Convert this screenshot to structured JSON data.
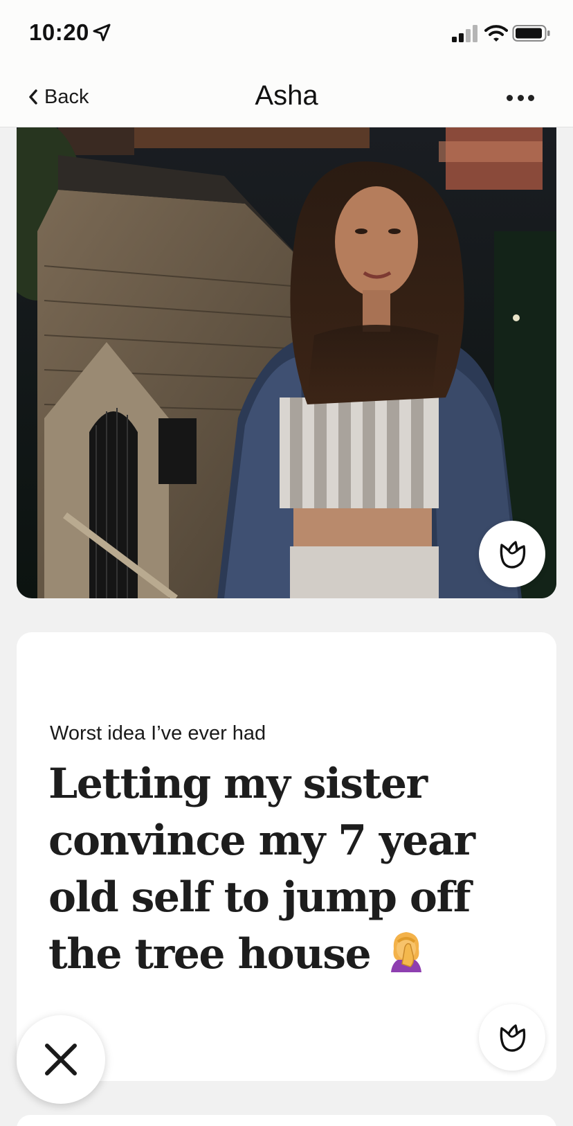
{
  "status_bar": {
    "time": "10:20",
    "icons": [
      "location-arrow-icon",
      "cellular-signal-icon",
      "wifi-icon",
      "battery-icon"
    ]
  },
  "nav": {
    "back_label": "Back",
    "title": "Asha",
    "more_icon": "more-horizontal-icon"
  },
  "photo": {
    "like_icon": "rose-icon"
  },
  "prompt": {
    "question": "Worst idea I’ve ever had",
    "answer": "Letting my sister convince my 7 year old self to jump off the tree house",
    "answer_emoji": "woman-facepalming",
    "like_icon": "rose-icon"
  },
  "actions": {
    "skip_icon": "close-icon"
  },
  "colors": {
    "background": "#f1f1f1",
    "card": "#ffffff",
    "text": "#1a1a1a"
  }
}
